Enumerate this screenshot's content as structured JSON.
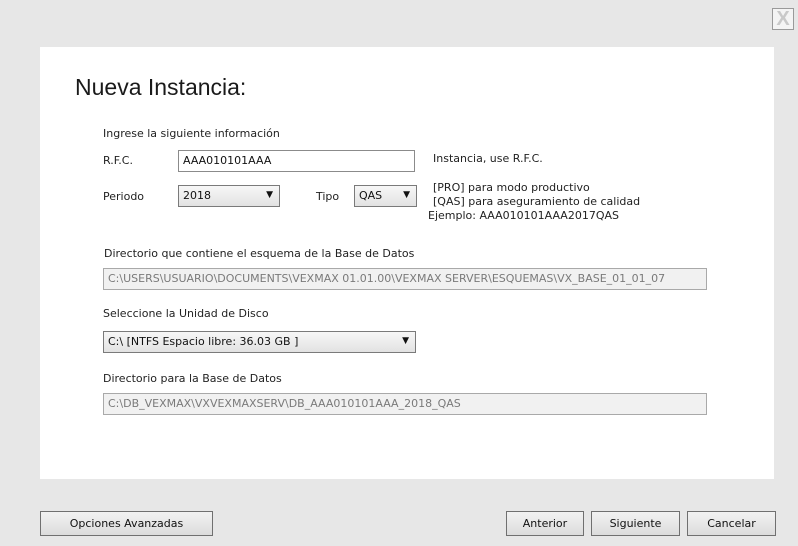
{
  "window": {
    "close_glyph": "X"
  },
  "dialog": {
    "title": "Nueva Instancia:",
    "intro": "Ingrese la siguiente información",
    "rfc": {
      "label": "R.F.C.",
      "value": "AAA010101AAA",
      "hint": "Instancia, use R.F.C."
    },
    "periodo": {
      "label": "Periodo",
      "value": "2018"
    },
    "tipo": {
      "label": "Tipo",
      "value": "QAS",
      "hints": [
        "[PRO] para modo productivo",
        "[QAS] para aseguramiento de calidad",
        "Ejemplo:  AAA010101AAA2017QAS"
      ]
    },
    "schema_dir": {
      "label": "Directorio que contiene el esquema de la Base de Datos",
      "value": "C:\\USERS\\USUARIO\\DOCUMENTS\\VEXMAX 01.01.00\\VEXMAX SERVER\\ESQUEMAS\\VX_BASE_01_01_07"
    },
    "disk": {
      "label": "Seleccione la Unidad de Disco",
      "value": "C:\\ [NTFS Espacio libre: 36.03 GB ]"
    },
    "db_dir": {
      "label": "Directorio para la Base de Datos",
      "value": "C:\\DB_VEXMAX\\VXVEXMAXSERV\\DB_AAA010101AAA_2018_QAS"
    }
  },
  "footer": {
    "advanced_label": "Opciones Avanzadas",
    "back_label": "Anterior",
    "next_label": "Siguiente",
    "cancel_label": "Cancelar"
  }
}
